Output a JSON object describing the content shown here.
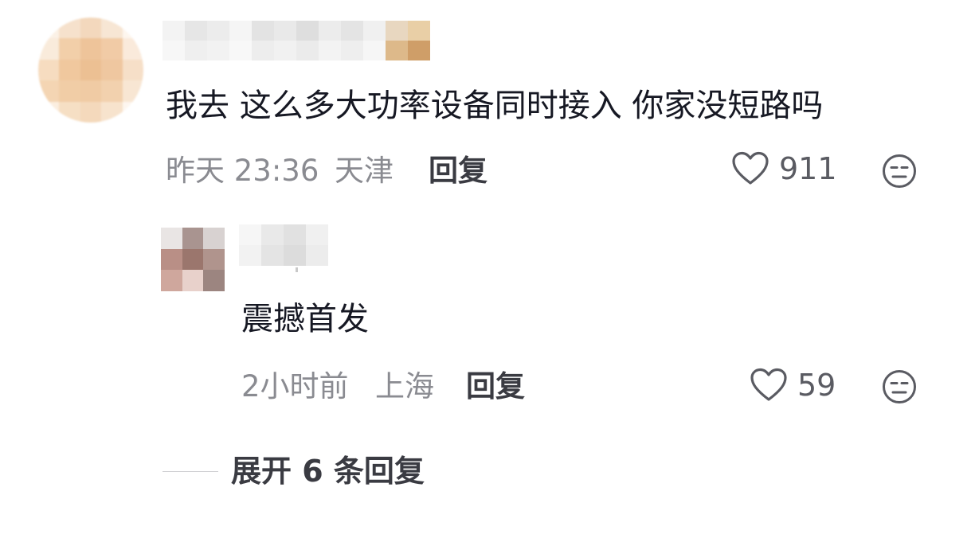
{
  "comments": [
    {
      "text": "我去 这么多大功率设备同时接入 你家没短路吗",
      "time": "昨天 23:36",
      "location": "天津",
      "reply_label": "回复",
      "like_count": "911"
    },
    {
      "text": "震撼首发",
      "time": "2小时前",
      "location": "上海",
      "reply_label": "回复",
      "like_count": "59"
    }
  ],
  "expand_label": "展开 6 条回复",
  "colors": {
    "text": "#161823",
    "meta": "#8a8b91",
    "reply": "#3a3b42",
    "icon": "#5a5b62"
  },
  "icons": {
    "like": "heart-outline-icon",
    "dislike": "unamused-face-icon"
  }
}
